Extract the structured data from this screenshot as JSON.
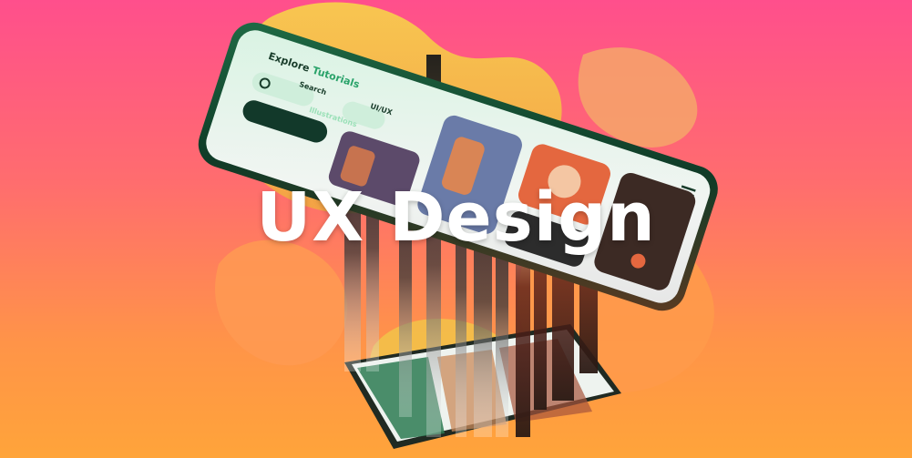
{
  "headline": "UX Design",
  "phone": {
    "title_prefix": "Explore",
    "title_accent": "Tutorials",
    "search_label": "Search",
    "chips": [
      "UI/UX",
      "Illustrations"
    ]
  },
  "colors": {
    "bg_top": "#ff4f8c",
    "bg_bottom": "#ffa43a",
    "accent_green": "#3bbf7a",
    "blob_yellow": "#e9d44a"
  },
  "icons": [
    "menu-icon",
    "search-icon"
  ]
}
